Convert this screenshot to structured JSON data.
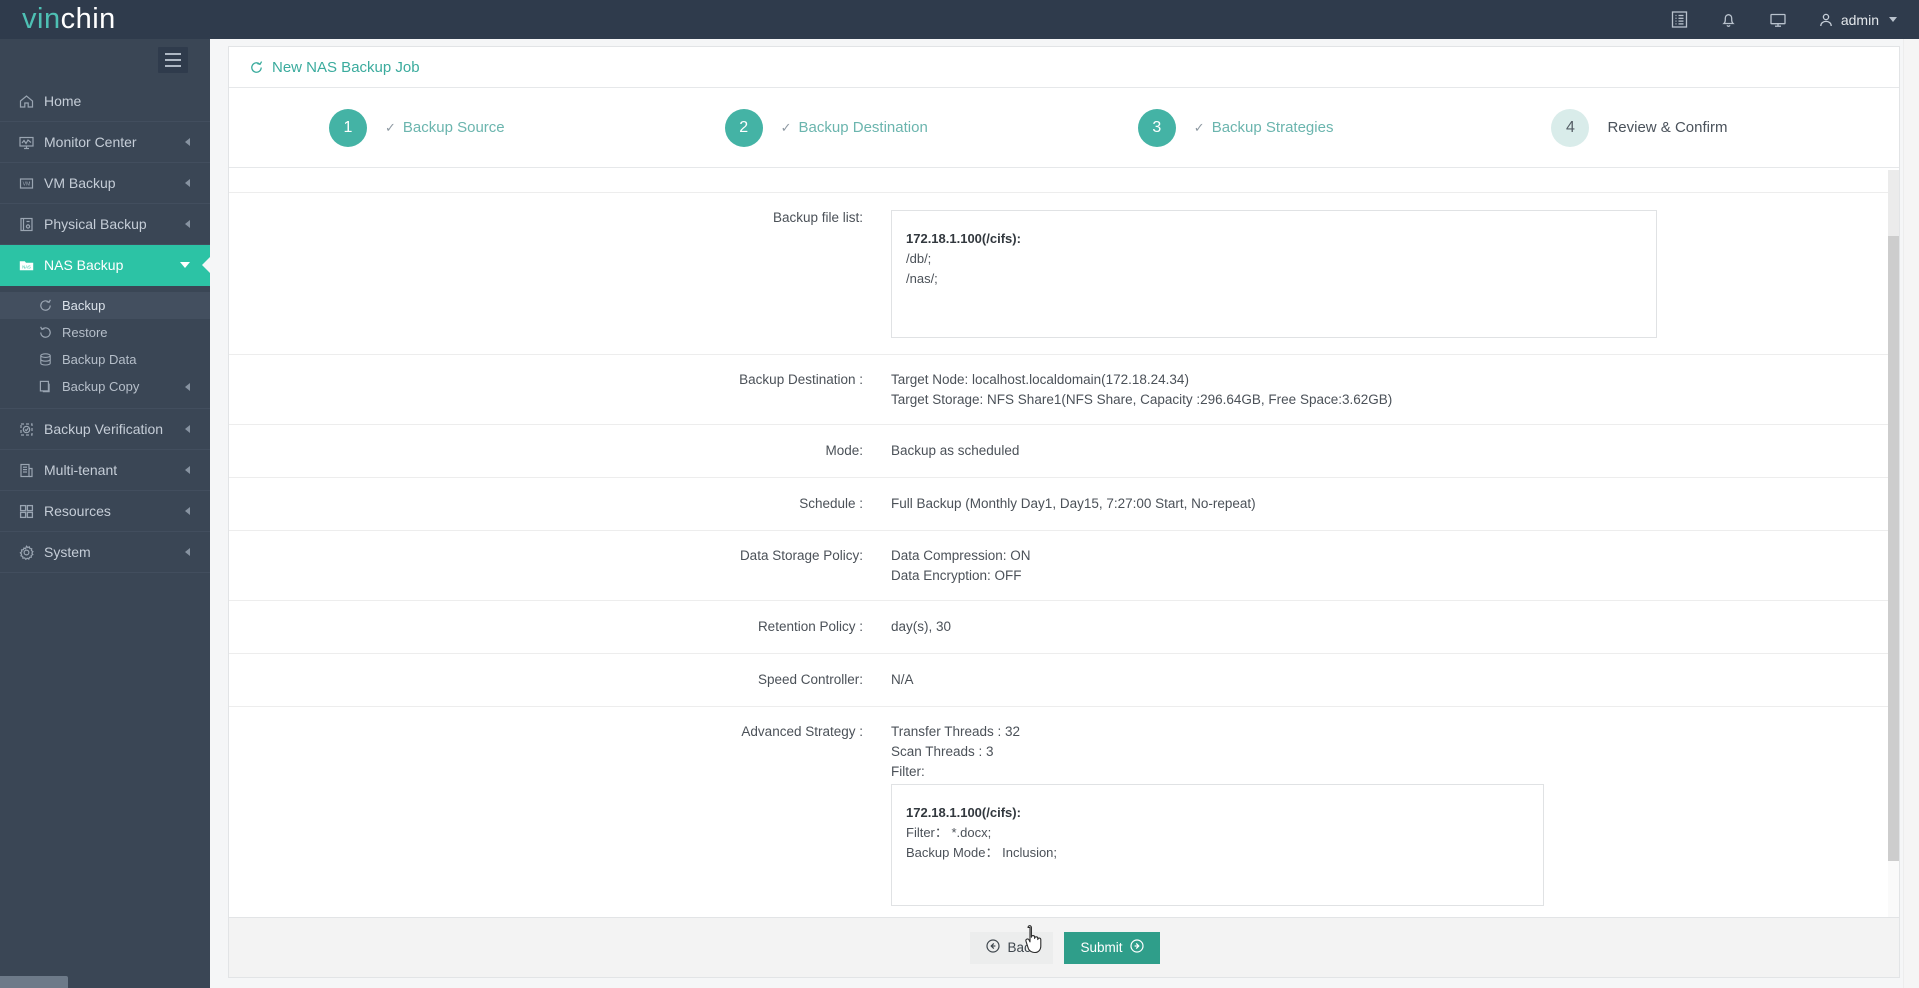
{
  "brand": {
    "part1": "vin",
    "part2": "chin"
  },
  "topbar": {
    "icons": [
      {
        "name": "log-icon",
        "label": "Logs"
      },
      {
        "name": "bell-icon",
        "label": "Notifications"
      },
      {
        "name": "monitor-icon",
        "label": "Console"
      }
    ],
    "user": "admin"
  },
  "sidebar": {
    "items": [
      {
        "label": "Home",
        "icon": "home-icon",
        "expandable": false,
        "active": false
      },
      {
        "label": "Monitor Center",
        "icon": "monitor-center-icon",
        "expandable": true,
        "active": false
      },
      {
        "label": "VM Backup",
        "icon": "vm-icon",
        "expandable": true,
        "active": false
      },
      {
        "label": "Physical Backup",
        "icon": "physical-backup-icon",
        "expandable": true,
        "active": false
      },
      {
        "label": "NAS Backup",
        "icon": "nas-icon",
        "expandable": true,
        "active": true
      },
      {
        "label": "Backup Verification",
        "icon": "shield-check-icon",
        "expandable": true,
        "active": false
      },
      {
        "label": "Multi-tenant",
        "icon": "multi-tenant-icon",
        "expandable": true,
        "active": false
      },
      {
        "label": "Resources",
        "icon": "resources-icon",
        "expandable": true,
        "active": false
      },
      {
        "label": "System",
        "icon": "gear-icon",
        "expandable": true,
        "active": false
      }
    ],
    "subitems": [
      {
        "label": "Backup",
        "icon": "backup-icon",
        "expandable": false,
        "selected": true
      },
      {
        "label": "Restore",
        "icon": "restore-icon",
        "expandable": false,
        "selected": false
      },
      {
        "label": "Backup Data",
        "icon": "database-icon",
        "expandable": false,
        "selected": false
      },
      {
        "label": "Backup Copy",
        "icon": "copy-icon",
        "expandable": true,
        "selected": false
      }
    ]
  },
  "page": {
    "title": "New NAS Backup Job",
    "steps": [
      {
        "number": "1",
        "label": "Backup Source",
        "state": "done"
      },
      {
        "number": "2",
        "label": "Backup Destination",
        "state": "done"
      },
      {
        "number": "3",
        "label": "Backup Strategies",
        "state": "done"
      },
      {
        "number": "4",
        "label": "Review & Confirm",
        "state": "todo"
      }
    ]
  },
  "review": {
    "backup_file_list": {
      "label": "Backup file list:",
      "host": "172.18.1.100(/cifs):",
      "lines": [
        "/db/;",
        "/nas/;"
      ]
    },
    "backup_destination": {
      "label": "Backup Destination :",
      "line1": "Target Node: localhost.localdomain(172.18.24.34)",
      "line2": "Target Storage: NFS Share1(NFS Share, Capacity :296.64GB, Free Space:3.62GB)"
    },
    "mode": {
      "label": "Mode:",
      "value": "Backup as scheduled"
    },
    "schedule": {
      "label": "Schedule :",
      "value": "Full Backup (Monthly Day1, Day15, 7:27:00 Start, No-repeat)"
    },
    "data_storage_policy": {
      "label": "Data Storage Policy:",
      "line1": "Data Compression: ON",
      "line2": "Data Encryption: OFF"
    },
    "retention_policy": {
      "label": "Retention Policy :",
      "value": "day(s), 30"
    },
    "speed_controller": {
      "label": "Speed Controller:",
      "value": "N/A"
    },
    "advanced_strategy": {
      "label": "Advanced Strategy :",
      "transfer_threads": "Transfer Threads : 32",
      "scan_threads": "Scan Threads : 3",
      "filter_label": "Filter:",
      "filter_host": "172.18.1.100(/cifs):",
      "filter_line": "Filter： *.docx;",
      "backup_mode_line": "Backup Mode： Inclusion;"
    }
  },
  "footer": {
    "back": "Back",
    "submit": "Submit"
  },
  "colors": {
    "brand_teal": "#2cc3a5",
    "step_active": "#44b3a5",
    "step_inactive": "#d9ecea",
    "submit_button": "#2f9e8a",
    "topbar_bg": "#2f3b4c",
    "sidebar_bg": "#3a4655",
    "title_text": "#3aab9d"
  }
}
